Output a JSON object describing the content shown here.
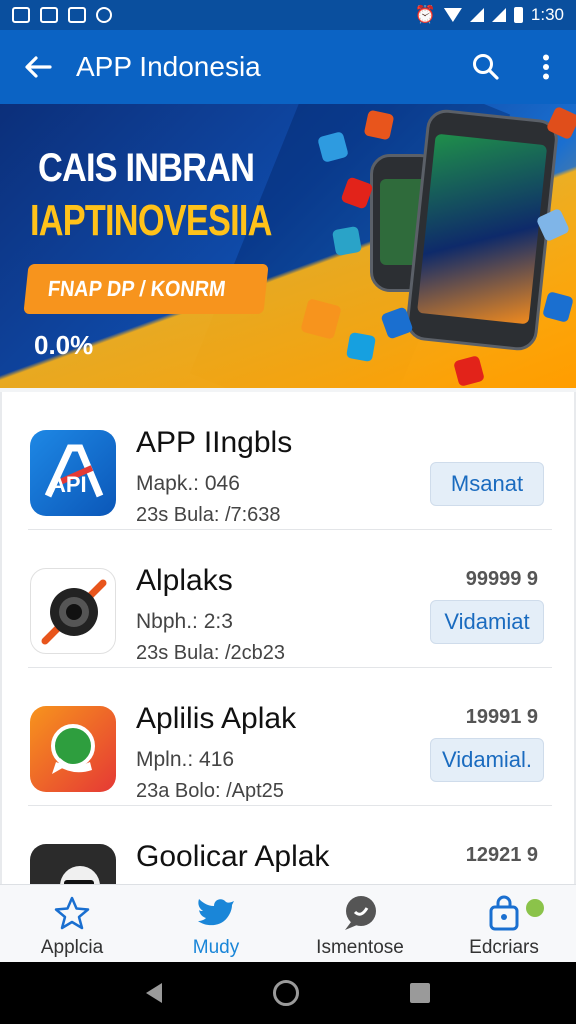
{
  "status_bar": {
    "time": "1:30"
  },
  "app_bar": {
    "title": "APP Indonesia",
    "back_icon": "arrow-back-icon",
    "search_icon": "search-icon",
    "more_icon": "more-vert-icon"
  },
  "banner": {
    "line1": "CAIS INBRAN",
    "line2": "IAPTINOVESIIA",
    "cta": "FNAP DP / KONRM",
    "badge": "0.0%",
    "colors": {
      "accent": "#ffc21a",
      "cta": "#f7941d",
      "blue": "#0f4aa8"
    }
  },
  "apps": [
    {
      "name": "APP IIngbls",
      "meta1": "Mapk.: 046",
      "meta2": "23s Bula: /7:638",
      "price": "",
      "button": "Msanat",
      "icon": "api-app-icon"
    },
    {
      "name": "Alplaks",
      "meta1": "Nbph.: 2:3",
      "meta2": "23s Bula: /2cb23",
      "price": "99999 9",
      "button": "Vidamiat",
      "icon": "camera-lens-icon"
    },
    {
      "name": "Aplilis Aplak",
      "meta1": "Mpln.: 416",
      "meta2": "23a Bolo: /Apt25",
      "price": "19991 9",
      "button": "Vidamial.",
      "icon": "whatsapp-style-icon"
    },
    {
      "name": "Goolicar Aplak",
      "meta1": "",
      "meta2": "",
      "price": "12921 9",
      "button": "",
      "icon": "character-app-icon"
    }
  ],
  "bottom_nav": [
    {
      "label": "Applcia",
      "icon": "star-icon",
      "active": false
    },
    {
      "label": "Mudy",
      "icon": "bird-icon",
      "active": true
    },
    {
      "label": "Ismentose",
      "icon": "chat-bubble-icon",
      "active": false
    },
    {
      "label": "Edcriars",
      "icon": "bag-icon",
      "active": false
    }
  ]
}
